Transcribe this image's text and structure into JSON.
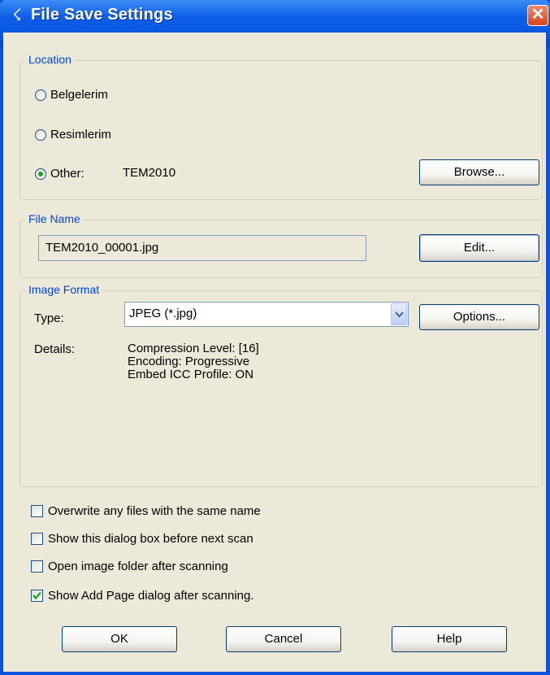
{
  "window": {
    "title": "File Save Settings",
    "close_label": "✕"
  },
  "location": {
    "legend": "Location",
    "options": [
      {
        "label": "Belgelerim",
        "checked": false
      },
      {
        "label": "Resimlerim",
        "checked": false
      },
      {
        "label": "Other:",
        "checked": true
      }
    ],
    "other_value": "TEM2010",
    "browse_label": "Browse..."
  },
  "file_name": {
    "legend": "File Name",
    "value": "TEM2010_00001.jpg",
    "edit_label": "Edit..."
  },
  "image_format": {
    "legend": "Image Format",
    "type_label": "Type:",
    "type_value": "JPEG (*.jpg)",
    "options_label": "Options...",
    "details_label": "Details:",
    "details": [
      "Compression Level: [16]",
      "Encoding: Progressive",
      "Embed ICC Profile: ON"
    ]
  },
  "checkboxes": [
    {
      "label": "Overwrite any files with the same name",
      "checked": false
    },
    {
      "label": "Show this dialog box before next scan",
      "checked": false
    },
    {
      "label": "Open image folder after scanning",
      "checked": false
    },
    {
      "label": "Show Add Page dialog after scanning.",
      "checked": true
    }
  ],
  "buttons": {
    "ok": "OK",
    "cancel": "Cancel",
    "help": "Help"
  },
  "colors": {
    "titlebar": "#0a55de",
    "dialog_bg": "#ece9d8",
    "legend": "#0046d5",
    "close": "#d9431f"
  }
}
